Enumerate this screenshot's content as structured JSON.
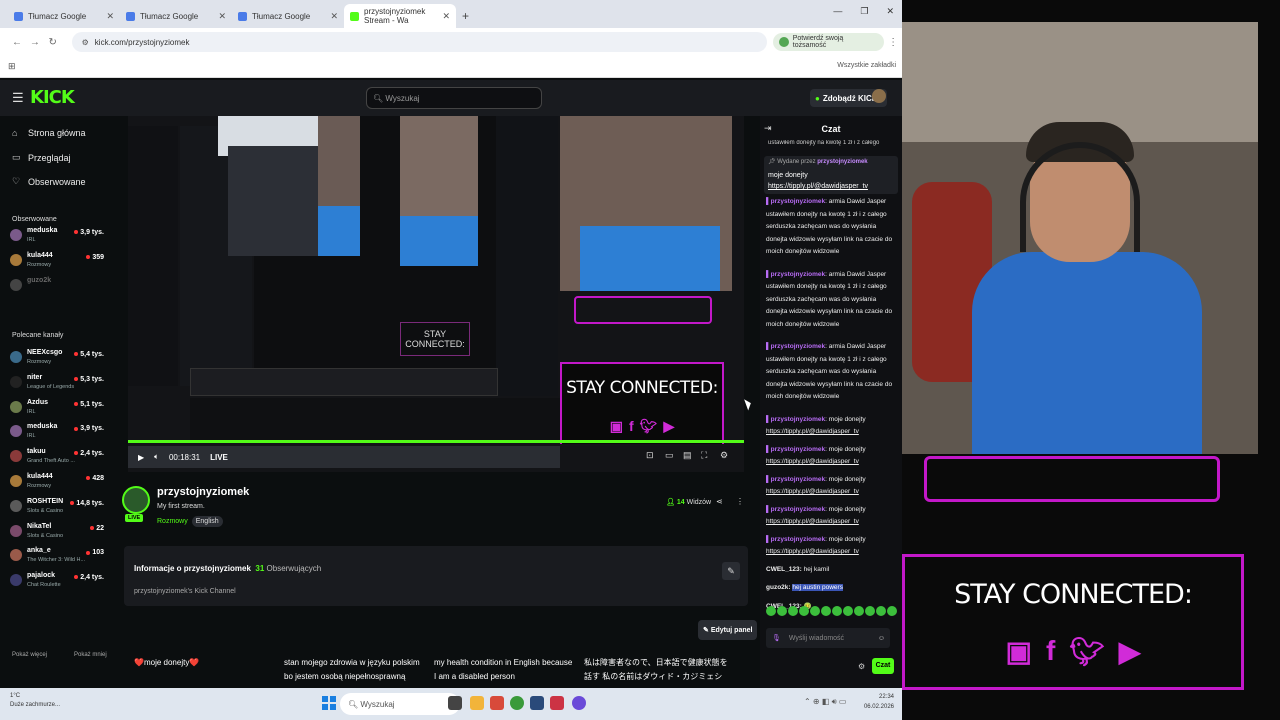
{
  "browser": {
    "tabs": [
      {
        "label": "Tłumacz Google"
      },
      {
        "label": "Tłumacz Google"
      },
      {
        "label": "Tłumacz Google"
      },
      {
        "label": "przystojnyziomek Stream - Wa"
      }
    ],
    "url": "kick.com/przystojnyziomek",
    "verify_label": "Potwierdź swoją tożsamość",
    "bookmarks_all": "Wszystkie zakładki"
  },
  "kick": {
    "search_placeholder": "Wyszukaj",
    "get_kicks": "Zdobądź KICKs",
    "nav": [
      "Strona główna",
      "Przeglądaj",
      "Obserwowane"
    ],
    "followed_heading": "Obserwowane",
    "followed": [
      {
        "name": "meduska",
        "category": "IRL",
        "viewers": "3,9 tys.",
        "color": "#7a5a8a"
      },
      {
        "name": "kula444",
        "category": "Rozmowy",
        "viewers": "359",
        "color": "#a87a3a"
      },
      {
        "name": "guzo2k",
        "category": "",
        "viewers": "",
        "color": "#444"
      }
    ],
    "recommended_heading": "Polecane kanały",
    "recommended": [
      {
        "name": "NEEXcsgo",
        "category": "Rozmowy",
        "viewers": "5,4 tys.",
        "color": "#3a6a8a"
      },
      {
        "name": "niter",
        "category": "League of Legends",
        "viewers": "5,3 tys.",
        "color": "#222"
      },
      {
        "name": "Azdus",
        "category": "IRL",
        "viewers": "5,1 tys.",
        "color": "#6a7a4a"
      },
      {
        "name": "meduska",
        "category": "IRL",
        "viewers": "3,9 tys.",
        "color": "#7a5a8a"
      },
      {
        "name": "takuu",
        "category": "Grand Theft Auto ...",
        "viewers": "2,4 tys.",
        "color": "#8a3a3a"
      },
      {
        "name": "kula444",
        "category": "Rozmowy",
        "viewers": "428",
        "color": "#a87a3a"
      },
      {
        "name": "ROSHTEIN",
        "category": "Slots & Casino",
        "viewers": "14,8 tys.",
        "color": "#5a5a5a"
      },
      {
        "name": "NikaTel",
        "category": "Slots & Casino",
        "viewers": "22",
        "color": "#7a4a6a"
      },
      {
        "name": "anka_e",
        "category": "The Witcher 3: Wild H...",
        "viewers": "103",
        "color": "#9a5a4a"
      },
      {
        "name": "pajalock",
        "category": "Chat Roulette",
        "viewers": "2,4 tys.",
        "color": "#3a3a6a"
      }
    ],
    "show_more": "Pokaż więcej",
    "show_less": "Pokaż mniej",
    "player": {
      "time": "00:18:31",
      "live": "LIVE",
      "stay_connected": "STAY CONNECTED:"
    },
    "streamer": {
      "name": "przystojnyziomek",
      "title": "My first stream.",
      "category": "Rozmowy",
      "language": "English",
      "live_badge": "LIVE",
      "viewers": "14",
      "viewers_label": "Widzów"
    },
    "about": {
      "heading": "Informacje o przystojnyziomek",
      "followers": "31",
      "followers_label": "Obserwujących",
      "description": "przystojnyziomek's Kick Channel",
      "edit_panel": "Edytuj panel"
    },
    "panels": [
      "❤️moje donejty❤️",
      "stan mojego zdrowia w języku polskim bo jestem osobą niepełnosprawną",
      "my health condition in English because I am a disabled person",
      "私は障害者なので、日本語で健康状態を話す 私の名前はダウィド・カジミェシュ。障害を持っていま"
    ],
    "chat": {
      "title": "Czat",
      "cut_top": "ustawiłem donejty na kwotę 1 zł i z całego",
      "pinned_by_label": "Wydane przez",
      "pinned_by": "przystojnyziomek",
      "pinned_text": "moje donejty",
      "pinned_link": "https://tipply.pl/@dawidjasper_tv",
      "messages": [
        {
          "user": "przystojnyziomek",
          "text": "armia Dawid Jasper ustawiłem donejty na kwotę 1 zł i z całego serduszka zachęcam was do wysłania donejta widzowie wysyłam link na czacie do moich donejtów widzowie",
          "kind": "long"
        },
        {
          "user": "przystojnyziomek",
          "text": "armia Dawid Jasper ustawiłem donejty na kwotę 1 zł i z całego serduszka zachęcam was do wysłania donejta widzowie wysyłam link na czacie do moich donejtów widzowie",
          "kind": "long"
        },
        {
          "user": "przystojnyziomek",
          "text": "armia Dawid Jasper ustawiłem donejty na kwotę 1 zł i z całego serduszka zachęcam was do wysłania donejta widzowie wysyłam link na czacie do moich donejtów widzowie",
          "kind": "long"
        },
        {
          "user": "przystojnyziomek",
          "text": "moje donejty",
          "link": "https://tipply.pl/@dawidjasper_tv"
        },
        {
          "user": "przystojnyziomek",
          "text": "moje donejty",
          "link": "https://tipply.pl/@dawidjasper_tv"
        },
        {
          "user": "przystojnyziomek",
          "text": "moje donejty",
          "link": "https://tipply.pl/@dawidjasper_tv"
        },
        {
          "user": "przystojnyziomek",
          "text": "moje donejty",
          "link": "https://tipply.pl/@dawidjasper_tv"
        },
        {
          "user": "przystojnyziomek",
          "text": "moje donejty",
          "link": "https://tipply.pl/@dawidjasper_tv"
        }
      ],
      "plain_messages": [
        {
          "user": "CWEL_123:",
          "text": "hej kamil"
        },
        {
          "user": "guzo2k:",
          "text": "hej austin powers"
        },
        {
          "user": "CWEL_123:",
          "text": "🤢"
        }
      ],
      "input_placeholder": "Wyślij wiadomość",
      "send_label": "Czat"
    }
  },
  "taskbar": {
    "weather_temp": "1°C",
    "weather_desc": "Duże zachmurze...",
    "search": "Wyszukaj",
    "time": "22:34",
    "date": "06.02.2026"
  },
  "webcam": {
    "stay_connected": "STAY CONNECTED:"
  },
  "colors": {
    "accent": "#53fc18",
    "overlay": "#c318c9",
    "chat_user": "#b86cf5"
  }
}
